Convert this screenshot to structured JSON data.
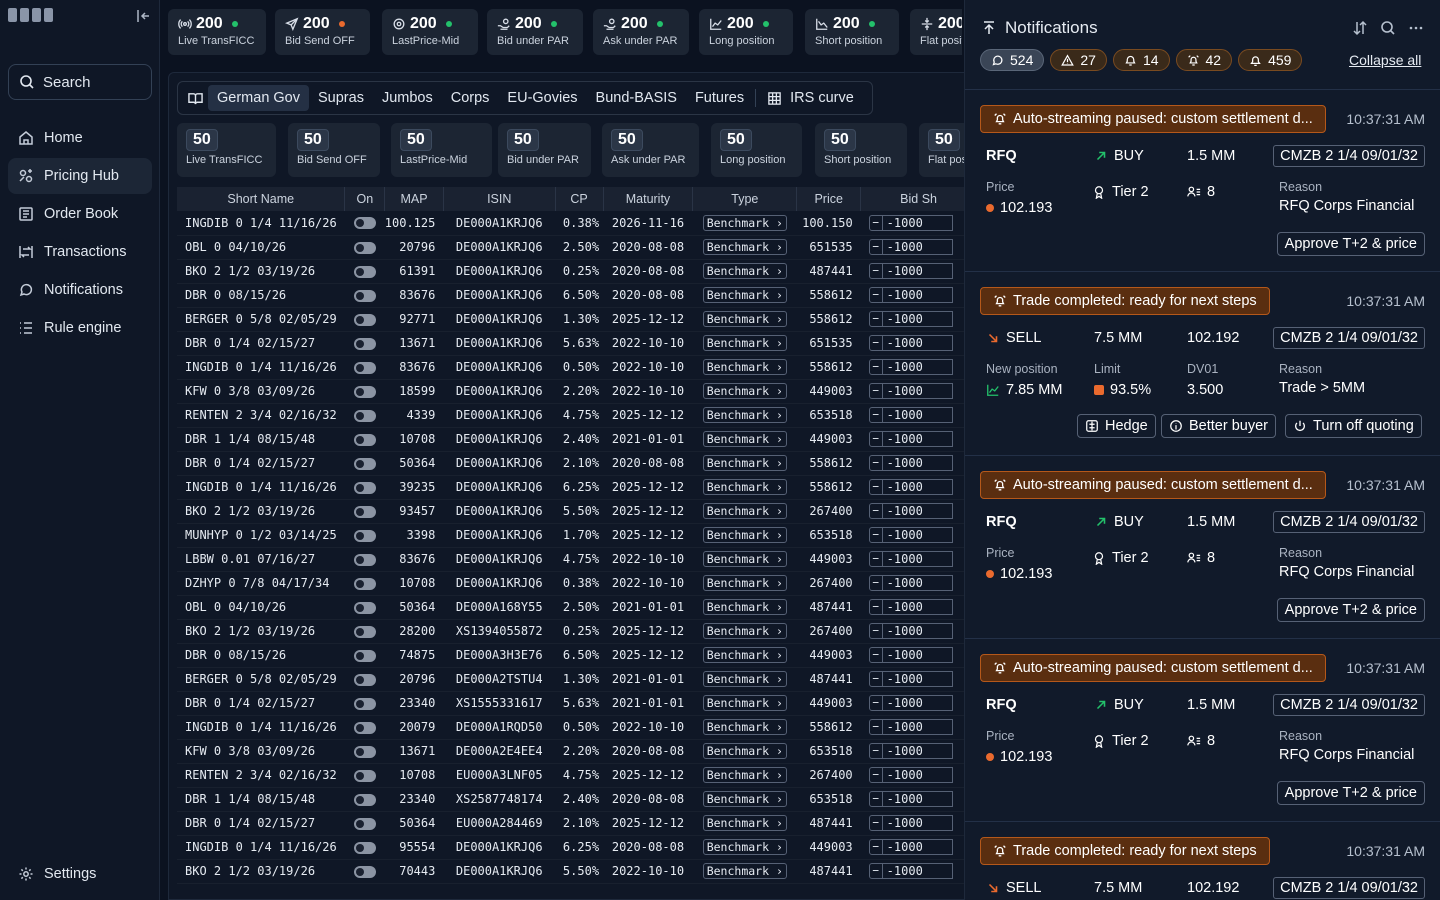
{
  "colors": {
    "accent_orange": "#ea6a2e",
    "pill_bg": "#5a2e10",
    "ok_green": "#23c16b",
    "bg": "#0b1220"
  },
  "sidebar": {
    "search_label": "Search",
    "items": [
      {
        "label": "Home",
        "icon": "home-icon"
      },
      {
        "label": "Pricing Hub",
        "icon": "pricing-hub-icon",
        "active": true
      },
      {
        "label": "Order Book",
        "icon": "order-book-icon"
      },
      {
        "label": "Transactions",
        "icon": "transactions-icon"
      },
      {
        "label": "Notifications",
        "icon": "notifications-icon"
      },
      {
        "label": "Rule engine",
        "icon": "rule-engine-icon"
      }
    ],
    "settings_label": "Settings"
  },
  "strategy_cards": [
    {
      "value": "200",
      "label": "Live TransFICC",
      "status": "green",
      "icon": "broadcast-icon"
    },
    {
      "value": "200",
      "label": "Bid Send OFF",
      "status": "orange",
      "icon": "send-icon"
    },
    {
      "value": "200",
      "label": "LastPrice-Mid",
      "status": "green",
      "icon": "target-icon"
    },
    {
      "value": "200",
      "label": "Bid under PAR",
      "status": "green",
      "icon": "hand-coins-icon"
    },
    {
      "value": "200",
      "label": "Ask under PAR",
      "status": "green",
      "icon": "hand-coins-icon"
    },
    {
      "value": "200",
      "label": "Long position",
      "status": "green",
      "icon": "chart-up-icon"
    },
    {
      "value": "200",
      "label": "Short position",
      "status": "green",
      "icon": "chart-down-icon"
    },
    {
      "value": "200",
      "label": "Flat position",
      "status": "green",
      "icon": "flat-icon"
    }
  ],
  "tabs": [
    "German Gov",
    "Supras",
    "Jumbos",
    "Corps",
    "EU-Govies",
    "Bund-BASIS",
    "Futures",
    "IRS curve"
  ],
  "active_tab": "German Gov",
  "tab_cards": [
    {
      "value": "50",
      "label": "Live TransFICC"
    },
    {
      "value": "50",
      "label": "Bid Send OFF"
    },
    {
      "value": "50",
      "label": "LastPrice-Mid"
    },
    {
      "value": "50",
      "label": "Bid under PAR"
    },
    {
      "value": "50",
      "label": "Ask under PAR"
    },
    {
      "value": "50",
      "label": "Long position"
    },
    {
      "value": "50",
      "label": "Short position"
    },
    {
      "value": "50",
      "label": "Flat position"
    }
  ],
  "table": {
    "columns": [
      "Short Name",
      "On",
      "MAP",
      "ISIN",
      "CP",
      "Maturity",
      "Type",
      "Price",
      "Bid Sh"
    ],
    "rows": [
      [
        "INGDIB 0 1/4 11/16/26",
        "100.125",
        "DE000A1KRJQ6",
        "0.38%",
        "2026-11-16",
        "Benchmark",
        "100.150",
        "-1000"
      ],
      [
        "OBL 0 04/10/26",
        "20796",
        "DE000A1KRJQ6",
        "2.50%",
        "2020-08-08",
        "Benchmark",
        "651535",
        "-1000"
      ],
      [
        "BKO 2 1/2 03/19/26",
        "61391",
        "DE000A1KRJQ6",
        "0.25%",
        "2020-08-08",
        "Benchmark",
        "487441",
        "-1000"
      ],
      [
        "DBR 0 08/15/26",
        "83676",
        "DE000A1KRJQ6",
        "6.50%",
        "2020-08-08",
        "Benchmark",
        "558612",
        "-1000"
      ],
      [
        "BERGER 0 5/8 02/05/29",
        "92771",
        "DE000A1KRJQ6",
        "1.30%",
        "2025-12-12",
        "Benchmark",
        "558612",
        "-1000"
      ],
      [
        "DBR 0 1/4 02/15/27",
        "13671",
        "DE000A1KRJQ6",
        "5.63%",
        "2022-10-10",
        "Benchmark",
        "651535",
        "-1000"
      ],
      [
        "INGDIB 0 1/4 11/16/26",
        "83676",
        "DE000A1KRJQ6",
        "0.50%",
        "2022-10-10",
        "Benchmark",
        "558612",
        "-1000"
      ],
      [
        "KFW 0 3/8 03/09/26",
        "18599",
        "DE000A1KRJQ6",
        "2.20%",
        "2022-10-10",
        "Benchmark",
        "449003",
        "-1000"
      ],
      [
        "RENTEN 2 3/4 02/16/32",
        "4339",
        "DE000A1KRJQ6",
        "4.75%",
        "2025-12-12",
        "Benchmark",
        "653518",
        "-1000"
      ],
      [
        "DBR 1 1/4 08/15/48",
        "10708",
        "DE000A1KRJQ6",
        "2.40%",
        "2021-01-01",
        "Benchmark",
        "449003",
        "-1000"
      ],
      [
        "DBR 0 1/4 02/15/27",
        "50364",
        "DE000A1KRJQ6",
        "2.10%",
        "2020-08-08",
        "Benchmark",
        "558612",
        "-1000"
      ],
      [
        "INGDIB 0 1/4 11/16/26",
        "39235",
        "DE000A1KRJQ6",
        "6.25%",
        "2025-12-12",
        "Benchmark",
        "558612",
        "-1000"
      ],
      [
        "BKO 2 1/2 03/19/26",
        "93457",
        "DE000A1KRJQ6",
        "5.50%",
        "2025-12-12",
        "Benchmark",
        "267400",
        "-1000"
      ],
      [
        "MUNHYP 0 1/2 03/14/25",
        "3398",
        "DE000A1KRJQ6",
        "1.70%",
        "2025-12-12",
        "Benchmark",
        "653518",
        "-1000"
      ],
      [
        "LBBW 0.01 07/16/27",
        "83676",
        "DE000A1KRJQ6",
        "4.75%",
        "2022-10-10",
        "Benchmark",
        "449003",
        "-1000"
      ],
      [
        "DZHYP 0 7/8 04/17/34",
        "10708",
        "DE000A1KRJQ6",
        "0.38%",
        "2022-10-10",
        "Benchmark",
        "267400",
        "-1000"
      ],
      [
        "OBL 0 04/10/26",
        "50364",
        "DE000A168Y55",
        "2.50%",
        "2021-01-01",
        "Benchmark",
        "487441",
        "-1000"
      ],
      [
        "BKO 2 1/2 03/19/26",
        "28200",
        "XS1394055872",
        "0.25%",
        "2025-12-12",
        "Benchmark",
        "267400",
        "-1000"
      ],
      [
        "DBR 0 08/15/26",
        "74875",
        "DE000A3H3E76",
        "6.50%",
        "2025-12-12",
        "Benchmark",
        "449003",
        "-1000"
      ],
      [
        "BERGER 0 5/8 02/05/29",
        "20796",
        "DE000A2TSTU4",
        "1.30%",
        "2021-01-01",
        "Benchmark",
        "487441",
        "-1000"
      ],
      [
        "DBR 0 1/4 02/15/27",
        "23340",
        "XS1555331617",
        "5.63%",
        "2021-01-01",
        "Benchmark",
        "449003",
        "-1000"
      ],
      [
        "INGDIB 0 1/4 11/16/26",
        "20079",
        "DE000A1RQD50",
        "0.50%",
        "2022-10-10",
        "Benchmark",
        "558612",
        "-1000"
      ],
      [
        "KFW 0 3/8 03/09/26",
        "13671",
        "DE000A2E4EE4",
        "2.20%",
        "2020-08-08",
        "Benchmark",
        "653518",
        "-1000"
      ],
      [
        "RENTEN 2 3/4 02/16/32",
        "10708",
        "EU000A3LNF05",
        "4.75%",
        "2025-12-12",
        "Benchmark",
        "267400",
        "-1000"
      ],
      [
        "DBR 1 1/4 08/15/48",
        "23340",
        "XS2587748174",
        "2.40%",
        "2020-08-08",
        "Benchmark",
        "653518",
        "-1000"
      ],
      [
        "DBR 0 1/4 02/15/27",
        "50364",
        "EU000A284469",
        "2.10%",
        "2025-12-12",
        "Benchmark",
        "487441",
        "-1000"
      ],
      [
        "INGDIB 0 1/4 11/16/26",
        "95554",
        "DE000A1KRJQ6",
        "6.25%",
        "2020-08-08",
        "Benchmark",
        "449003",
        "-1000"
      ],
      [
        "BKO 2 1/2 03/19/26",
        "70443",
        "DE000A1KRJQ6",
        "5.50%",
        "2022-10-10",
        "Benchmark",
        "487441",
        "-1000"
      ]
    ]
  },
  "notifications": {
    "title": "Notifications",
    "collapse_all": "Collapse all",
    "counts": [
      {
        "value": "524",
        "icon": "chat-bubble-icon"
      },
      {
        "value": "27",
        "icon": "warning-triangle-icon"
      },
      {
        "value": "14",
        "icon": "bell-ring-icon"
      },
      {
        "value": "42",
        "icon": "alarm-icon"
      },
      {
        "value": "459",
        "icon": "bell-icon"
      }
    ],
    "cards": [
      {
        "kind": "rfq",
        "title": "Auto-streaming paused: custom settlement d...",
        "time": "10:37:31 AM",
        "type": "RFQ",
        "side": "BUY",
        "size": "1.5 MM",
        "isin": "CMZB 2 1/4 09/01/32",
        "price_label": "Price",
        "price": "102.193",
        "tier": "Tier 2",
        "count": "8",
        "reason_label": "Reason",
        "reason": "RFQ Corps Financial",
        "action": "Approve T+2 & price"
      },
      {
        "kind": "trade",
        "title": "Trade completed: ready for next steps",
        "time": "10:37:31 AM",
        "side": "SELL",
        "size": "7.5 MM",
        "price": "102.192",
        "isin": "CMZB 2 1/4 09/01/32",
        "newpos_label": "New position",
        "newpos": "7.85 MM",
        "limit_label": "Limit",
        "limit": "93.5%",
        "dv_label": "DV01",
        "dv": "3.500",
        "reason_label": "Reason",
        "reason": "Trade > 5MM",
        "actions": [
          "Hedge",
          "Better buyer",
          "Turn off quoting"
        ]
      },
      {
        "kind": "rfq",
        "title": "Auto-streaming paused: custom settlement d...",
        "time": "10:37:31 AM",
        "type": "RFQ",
        "side": "BUY",
        "size": "1.5 MM",
        "isin": "CMZB 2 1/4 09/01/32",
        "price_label": "Price",
        "price": "102.193",
        "tier": "Tier 2",
        "count": "8",
        "reason_label": "Reason",
        "reason": "RFQ Corps Financial",
        "action": "Approve T+2 & price"
      },
      {
        "kind": "rfq",
        "title": "Auto-streaming paused: custom settlement d...",
        "time": "10:37:31 AM",
        "type": "RFQ",
        "side": "BUY",
        "size": "1.5 MM",
        "isin": "CMZB 2 1/4 09/01/32",
        "price_label": "Price",
        "price": "102.193",
        "tier": "Tier 2",
        "count": "8",
        "reason_label": "Reason",
        "reason": "RFQ Corps Financial",
        "action": "Approve T+2 & price"
      },
      {
        "kind": "trade",
        "title": "Trade completed: ready for next steps",
        "time": "10:37:31 AM",
        "side": "SELL",
        "size": "7.5 MM",
        "price": "102.192",
        "isin": "CMZB 2 1/4 09/01/32"
      }
    ]
  }
}
